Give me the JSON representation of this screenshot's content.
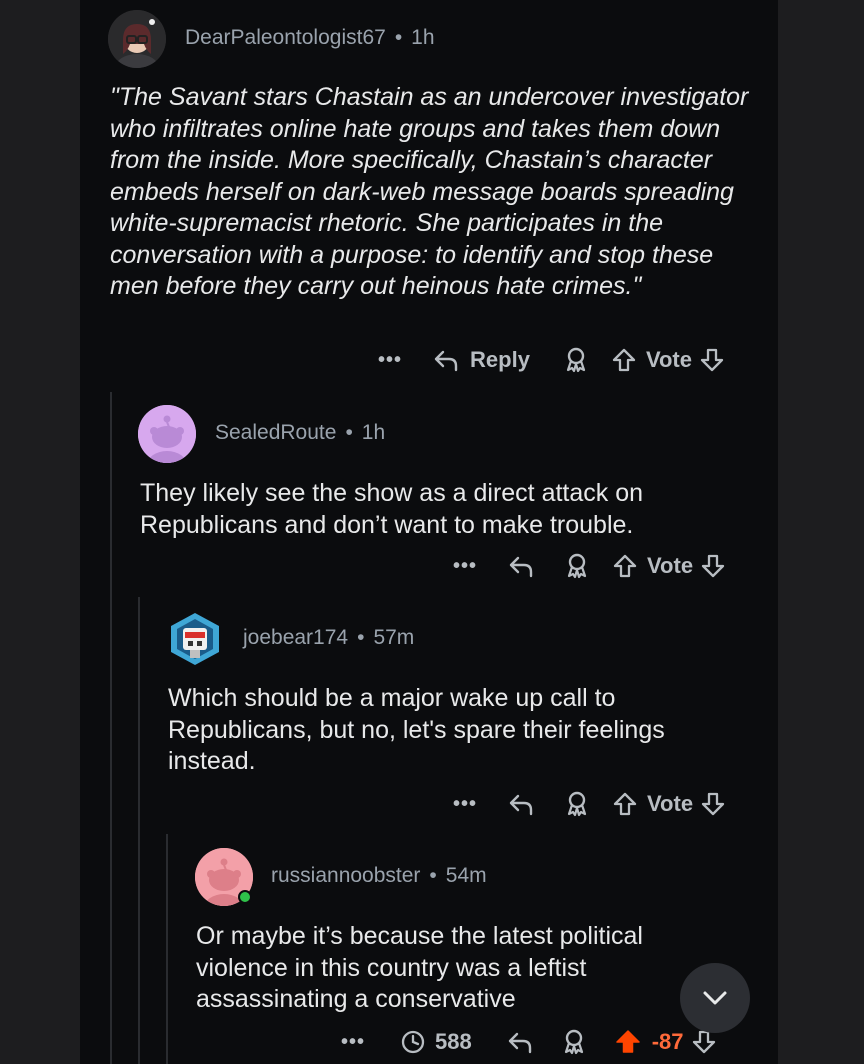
{
  "comments": [
    {
      "username": "DearPaleontologist67",
      "time": "1h",
      "body": "\"The Savant stars Chastain as an undercover investigator who infiltrates online hate groups and takes them down from the inside. More specifically, Chastain’s character embeds herself on dark-web message boards spreading white-supremacist rhetoric. She participates in the conversation with a purpose: to identify and stop these men before they carry out heinous hate crimes.\"",
      "more": "•••",
      "reply_label": "Reply",
      "vote_label": "Vote"
    },
    {
      "username": "SealedRoute",
      "time": "1h",
      "body": "They likely see the show as a direct attack on Republicans and don’t want to make trouble.",
      "more": "•••",
      "vote_label": "Vote"
    },
    {
      "username": "joebear174",
      "time": "57m",
      "body": "Which should be a major wake up call to Republicans, but no, let's spare their feelings instead.",
      "more": "•••",
      "vote_label": "Vote"
    },
    {
      "username": "russiannoobster",
      "time": "54m",
      "body": "Or maybe it’s because the latest political violence in this country was a leftist assassinating a conservative",
      "more": "•••",
      "award_count": "588",
      "score": "-87"
    }
  ],
  "dot": "•",
  "colors": {
    "background": "#0b0c0e",
    "upvote_active": "#ff4500",
    "score": "#ff6a3a",
    "online": "#2fc24a"
  },
  "icons": [
    "reply-icon",
    "award-icon",
    "upvote-icon",
    "downvote-icon",
    "clock-icon",
    "chevron-down-icon"
  ]
}
